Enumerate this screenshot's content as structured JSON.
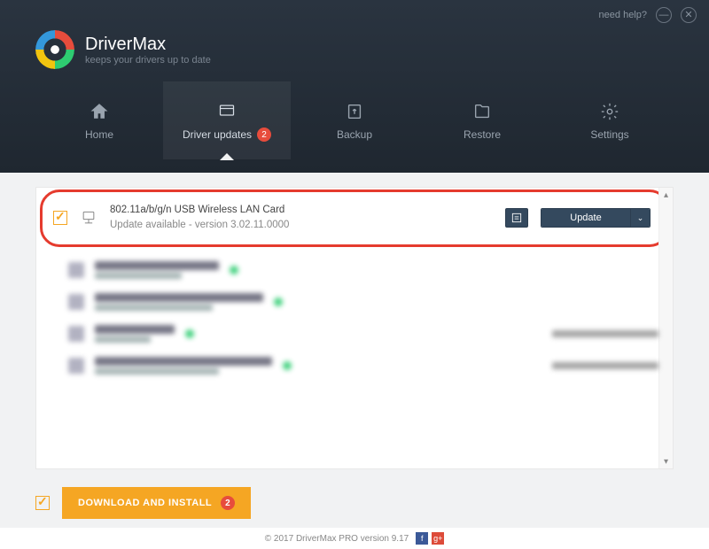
{
  "titlebar": {
    "help": "need help?"
  },
  "brand": {
    "title": "DriverMax",
    "subtitle": "keeps your drivers up to date"
  },
  "tabs": {
    "home": "Home",
    "updates": "Driver updates",
    "updates_badge": "2",
    "backup": "Backup",
    "restore": "Restore",
    "settings": "Settings"
  },
  "driver": {
    "name": "802.11a/b/g/n USB Wireless LAN Card",
    "status": "Update available - version 3.02.11.0000",
    "update_label": "Update"
  },
  "blurred_items": [
    {
      "title_w": 140,
      "has_right": false
    },
    {
      "title_w": 190,
      "has_right": false
    },
    {
      "title_w": 90,
      "has_right": true
    },
    {
      "title_w": 200,
      "has_right": true
    }
  ],
  "footer": {
    "download": "DOWNLOAD AND INSTALL",
    "download_badge": "2"
  },
  "copyright": "© 2017 DriverMax PRO version 9.17"
}
